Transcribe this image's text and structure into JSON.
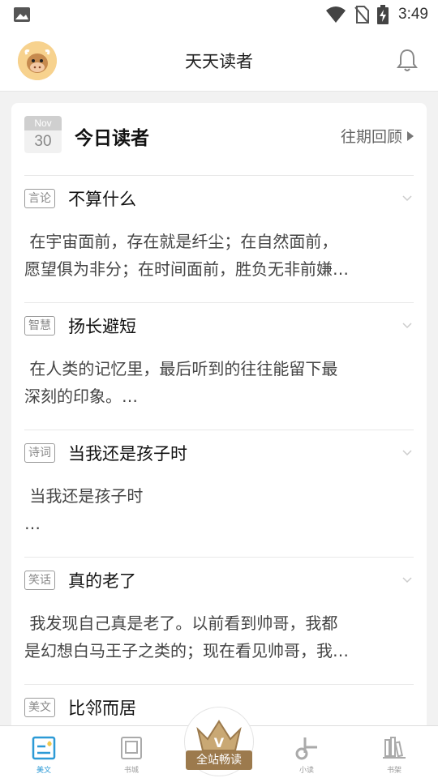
{
  "status_bar": {
    "time": "3:49",
    "icons": [
      "gallery-icon",
      "wifi-icon",
      "no-sim-icon",
      "battery-charging-icon"
    ]
  },
  "app_bar": {
    "title": "天天读者",
    "avatar_icon": "cow-avatar",
    "bell_icon": "bell-icon"
  },
  "today": {
    "month": "Nov",
    "day": "30",
    "title": "今日读者",
    "archive_label": "往期回顾"
  },
  "articles": [
    {
      "tag": "言论",
      "title": "不算什么",
      "excerpt": " 在宇宙面前，存在就是纤尘；在自然面前，\n愿望俱为非分；在时间面前，胜负无非前嫌…"
    },
    {
      "tag": "智慧",
      "title": "扬长避短",
      "excerpt": " 在人类的记忆里，最后听到的往往能留下最\n深刻的印象。…"
    },
    {
      "tag": "诗词",
      "title": "当我还是孩子时",
      "excerpt": " 当我还是孩子时\n…"
    },
    {
      "tag": "笑话",
      "title": "真的老了",
      "excerpt": " 我发现自己真是老了。以前看到帅哥，我都\n是幻想白马王子之类的；现在看见帅哥，我…"
    },
    {
      "tag": "美文",
      "title": "比邻而居",
      "excerpt": ""
    }
  ],
  "bottom_nav": {
    "items": [
      {
        "label": "美文",
        "icon": "article-icon",
        "active": true
      },
      {
        "label": "书城",
        "icon": "bookstore-icon",
        "active": false
      },
      {
        "label": "小读",
        "icon": "music-note-icon",
        "active": false
      },
      {
        "label": "书架",
        "icon": "bookshelf-icon",
        "active": false
      }
    ],
    "center_label": "全站畅读",
    "center_icon": "crown-icon"
  },
  "colors": {
    "accent": "#2c9ad6",
    "crown_gold": "#9c7a4d",
    "background": "#f2f2f2"
  }
}
